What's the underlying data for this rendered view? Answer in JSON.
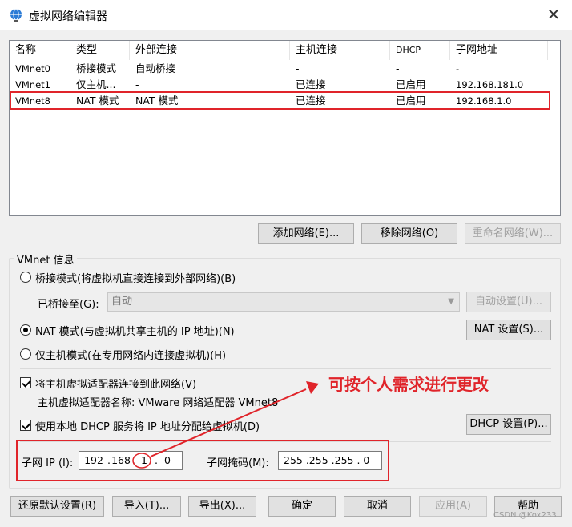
{
  "window": {
    "title": "虚拟网络编辑器",
    "close_glyph": "✕"
  },
  "network_list": {
    "columns": [
      "名称",
      "类型",
      "外部连接",
      "主机连接",
      "DHCP",
      "子网地址"
    ],
    "rows": [
      [
        "VMnet0",
        "桥接模式",
        "自动桥接",
        "-",
        "-",
        "-"
      ],
      [
        "VMnet1",
        "仅主机...",
        "-",
        "已连接",
        "已启用",
        "192.168.181.0"
      ],
      [
        "VMnet8",
        "NAT 模式",
        "NAT 模式",
        "已连接",
        "已启用",
        "192.168.1.0"
      ]
    ],
    "selected_row": "VMnet8"
  },
  "list_buttons": {
    "add": "添加网络(E)...",
    "remove": "移除网络(O)",
    "rename": "重命名网络(W)..."
  },
  "vmnet_info": {
    "group_label": "VMnet 信息",
    "bridged_radio": "桥接模式(将虚拟机直接连接到外部网络)(B)",
    "bridged_to_label": "已桥接至(G):",
    "bridged_to_value": "自动",
    "auto_settings": "自动设置(U)...",
    "nat_radio": "NAT 模式(与虚拟机共享主机的 IP 地址)(N)",
    "nat_settings": "NAT 设置(S)...",
    "host_only_radio": "仅主机模式(在专用网络内连接虚拟机)(H)",
    "connect_adapter_check": "将主机虚拟适配器连接到此网络(V)",
    "adapter_name_text": "主机虚拟适配器名称: VMware 网络适配器 VMnet8",
    "dhcp_check": "使用本地 DHCP 服务将 IP 地址分配给虚拟机(D)",
    "dhcp_settings": "DHCP 设置(P)...",
    "subnet_ip_label": "子网 IP (I):",
    "subnet_ip": [
      "192",
      "168",
      "1",
      "0"
    ],
    "subnet_mask_label": "子网掩码(M):",
    "subnet_mask": "255 .255 .255 . 0",
    "selected_mode": "nat"
  },
  "annotation": {
    "text": "可按个人需求进行更改",
    "color": "#e0242a"
  },
  "bottom_buttons": {
    "restore": "还原默认设置(R)",
    "import": "导入(T)...",
    "export": "导出(X)...",
    "ok": "确定",
    "cancel": "取消",
    "apply": "应用(A)",
    "help": "帮助"
  },
  "watermark": "CSDN @Kox233",
  "colors": {
    "dialog_bg": "#f0f0f0",
    "highlight_red": "#e0242a",
    "disabled_text": "#a0a0a0"
  }
}
